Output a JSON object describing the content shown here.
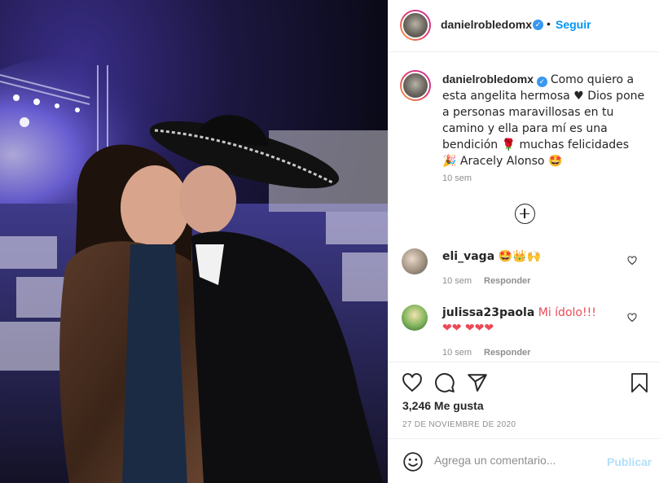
{
  "post": {
    "username": "danielrobledomx",
    "follow_label": "Seguir",
    "separator": "•",
    "caption_text": "Como quiero a esta angelita hermosa ♥ Dios pone a personas maravillosas en tu camino y ella para mí es una bendición 🌹 muchas felicidades 🎉 Aracely Alonso 🤩",
    "caption_time": "10 sem",
    "likes": "3,246 Me gusta",
    "date": "27 DE NOVIEMBRE DE 2020"
  },
  "comments": [
    {
      "username": "eli_vaga",
      "text": "🤩👑🙌",
      "time": "10 sem",
      "reply_label": "Responder"
    },
    {
      "username": "julissa23paola",
      "text": "Mi ídolo!!! ❤❤ ❤❤❤",
      "time": "10 sem",
      "reply_label": "Responder"
    }
  ],
  "add_comment": {
    "placeholder": "Agrega un comentario...",
    "publish_label": "Publicar"
  },
  "icons": [
    "like-icon",
    "comment-icon",
    "share-icon",
    "save-icon",
    "emoji-icon",
    "verified-icon",
    "more-comments-icon",
    "heart-small-icon"
  ],
  "colors": {
    "accent": "#0095f6",
    "publish_disabled": "#b2dffc",
    "muted": "#8e8e8e",
    "text": "#262626",
    "heart_red": "#ed4956"
  }
}
